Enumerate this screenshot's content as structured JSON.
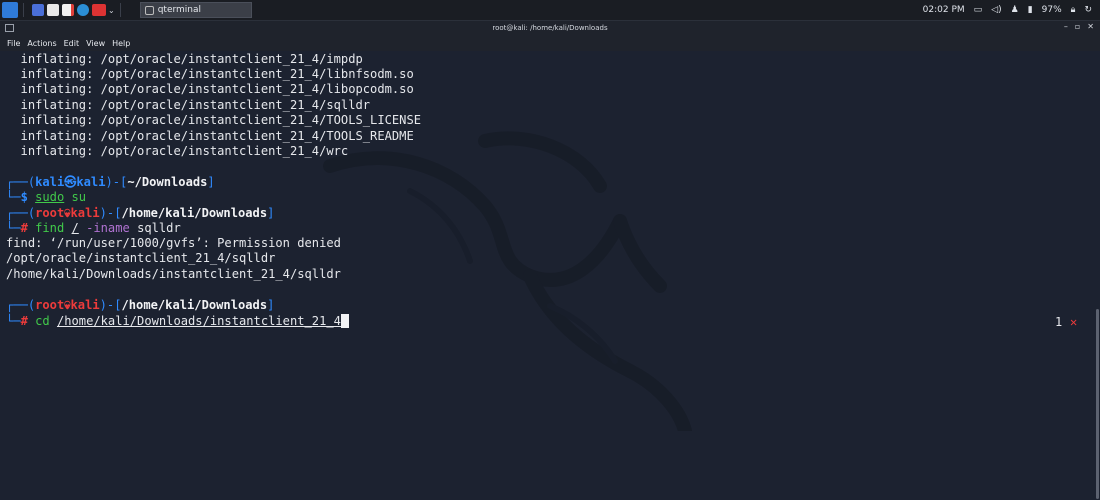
{
  "panel": {
    "taskbar_title": "qterminal",
    "clock": "02:02 PM",
    "battery": "97%"
  },
  "window": {
    "title": "root@kali: /home/kali/Downloads"
  },
  "menubar": [
    "File",
    "Actions",
    "Edit",
    "View",
    "Help"
  ],
  "output_lines": [
    "  inflating: /opt/oracle/instantclient_21_4/impdp",
    "  inflating: /opt/oracle/instantclient_21_4/libnfsodm.so",
    "  inflating: /opt/oracle/instantclient_21_4/libopcodm.so",
    "  inflating: /opt/oracle/instantclient_21_4/sqlldr",
    "  inflating: /opt/oracle/instantclient_21_4/TOOLS_LICENSE",
    "  inflating: /opt/oracle/instantclient_21_4/TOOLS_README",
    "  inflating: /opt/oracle/instantclient_21_4/wrc"
  ],
  "prompt1": {
    "user": "kali",
    "host": "kali",
    "path": "~/Downloads",
    "symbol": "$",
    "cmd": "sudo",
    "args": " su"
  },
  "prompt2": {
    "user": "root",
    "host": "kali",
    "path": "/home/kali/Downloads",
    "symbol": "#",
    "cmd": "find",
    "arg_path": "/",
    "arg_flag": "-iname",
    "arg_value": "sqlldr"
  },
  "find_output": [
    "find: ‘/run/user/1000/gvfs’: Permission denied",
    "/opt/oracle/instantclient_21_4/sqlldr",
    "/home/kali/Downloads/instantclient_21_4/sqlldr"
  ],
  "prompt3": {
    "user": "root",
    "host": "kali",
    "path": "/home/kali/Downloads",
    "symbol": "#",
    "cmd": "cd",
    "arg_path": "/home/kali/Downloads/instantclient_21_4"
  },
  "status": {
    "exit_code": "1",
    "fail_mark": "✕"
  },
  "colors": {
    "background": "#1c2230",
    "prompt_frame": "#2f8bff",
    "root": "#ee3b3b",
    "command": "#41c94a"
  }
}
